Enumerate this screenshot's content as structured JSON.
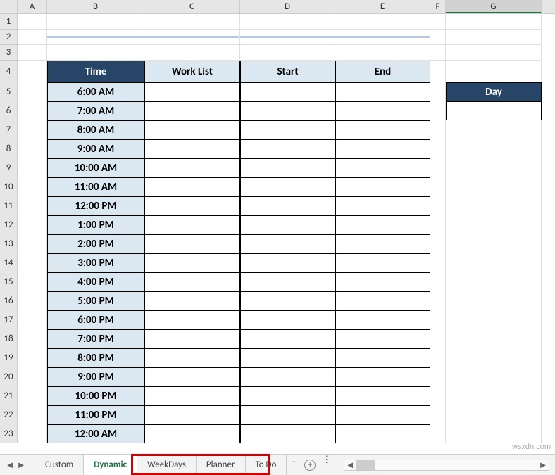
{
  "columns": [
    "A",
    "B",
    "C",
    "D",
    "E",
    "F",
    "G"
  ],
  "rows": [
    "1",
    "2",
    "3",
    "4",
    "5",
    "6",
    "7",
    "8",
    "9",
    "10",
    "11",
    "12",
    "13",
    "14",
    "15",
    "16",
    "17",
    "18",
    "19",
    "20",
    "21",
    "22",
    "23"
  ],
  "table": {
    "headers": [
      "Time",
      "Work List",
      "Start",
      "End"
    ],
    "times": [
      "6:00 AM",
      "7:00 AM",
      "8:00 AM",
      "9:00 AM",
      "10:00 AM",
      "11:00 AM",
      "12:00 PM",
      "1:00 PM",
      "2:00 PM",
      "3:00 PM",
      "4:00 PM",
      "5:00 PM",
      "6:00 PM",
      "7:00 PM",
      "8:00 PM",
      "9:00 PM",
      "10:00 PM",
      "11:00 PM",
      "12:00 AM"
    ]
  },
  "side": {
    "day_label": "Day",
    "day_value": ""
  },
  "tabs": {
    "items": [
      "Custom",
      "Dynamic",
      "WeekDays",
      "Planner",
      "To Do"
    ],
    "active": "Dynamic",
    "ellipsis": "..."
  },
  "watermark": "wsxdn.com"
}
